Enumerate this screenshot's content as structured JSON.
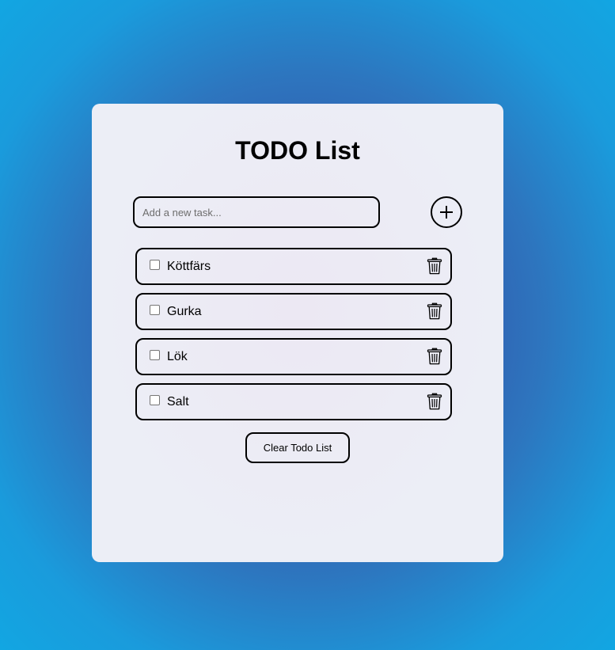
{
  "app": {
    "title": "TODO List"
  },
  "input": {
    "placeholder": "Add a new task...",
    "value": ""
  },
  "add_button": {
    "icon": "plus-icon"
  },
  "todos": [
    {
      "label": "Köttfärs",
      "checked": false,
      "icon": "trash-icon"
    },
    {
      "label": "Gurka",
      "checked": false,
      "icon": "trash-icon"
    },
    {
      "label": "Lök",
      "checked": false,
      "icon": "trash-icon"
    },
    {
      "label": "Salt",
      "checked": false,
      "icon": "trash-icon"
    }
  ],
  "clear_button": {
    "label": "Clear Todo List"
  }
}
